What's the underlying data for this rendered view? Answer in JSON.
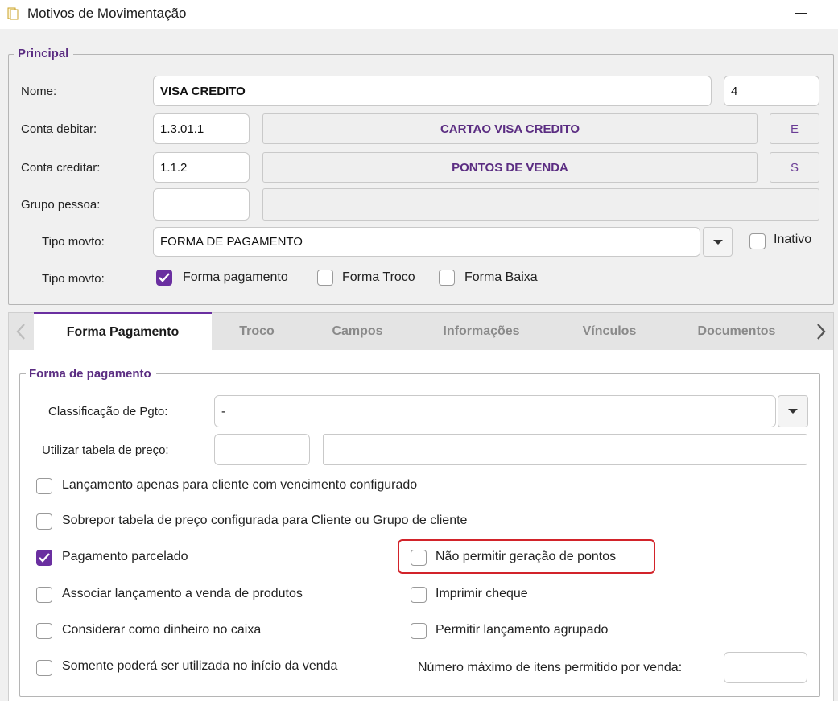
{
  "window": {
    "title": "Motivos de Movimentação"
  },
  "principal": {
    "legend": "Principal",
    "nome": {
      "label": "Nome:",
      "value": "VISA CREDITO",
      "code": "4"
    },
    "conta_debitar": {
      "label": "Conta debitar:",
      "code": "1.3.01.1",
      "description": "CARTAO VISA CREDITO",
      "flag": "E"
    },
    "conta_creditar": {
      "label": "Conta creditar:",
      "code": "1.1.2",
      "description": "PONTOS DE VENDA",
      "flag": "S"
    },
    "grupo_pessoa": {
      "label": "Grupo pessoa:",
      "code": "",
      "description": ""
    },
    "tipo_movto_select": {
      "label": "Tipo movto:",
      "value": "FORMA DE PAGAMENTO"
    },
    "inativo": {
      "label": "Inativo",
      "checked": false
    },
    "tipo_movto_checks": {
      "label": "Tipo movto:",
      "forma_pagamento": {
        "label": "Forma pagamento",
        "checked": true
      },
      "forma_troco": {
        "label": "Forma Troco",
        "checked": false
      },
      "forma_baixa": {
        "label": "Forma Baixa",
        "checked": false
      }
    }
  },
  "tabs": [
    {
      "label": "Forma Pagamento",
      "active": true
    },
    {
      "label": "Troco",
      "active": false
    },
    {
      "label": "Campos",
      "active": false
    },
    {
      "label": "Informações",
      "active": false
    },
    {
      "label": "Vínculos",
      "active": false
    },
    {
      "label": "Documentos",
      "active": false
    }
  ],
  "forma_pagamento": {
    "legend": "Forma de pagamento",
    "classificacao": {
      "label": "Classificação de Pgto:",
      "value": "-"
    },
    "tabela_preco": {
      "label": "Utilizar tabela de preço:",
      "code": "",
      "description": ""
    },
    "options": {
      "lancamento_apenas": {
        "label": "Lançamento apenas para cliente com vencimento configurado",
        "checked": false
      },
      "sobrepor_tabela": {
        "label": "Sobrepor tabela de preço configurada para Cliente ou Grupo de cliente",
        "checked": false
      },
      "pagamento_parcelado": {
        "label": "Pagamento parcelado",
        "checked": true
      },
      "nao_permitir_pontos": {
        "label": "Não permitir geração de pontos",
        "checked": false
      },
      "associar_lancamento": {
        "label": "Associar lançamento a venda de produtos",
        "checked": false
      },
      "imprimir_cheque": {
        "label": "Imprimir cheque",
        "checked": false
      },
      "considerar_dinheiro": {
        "label": "Considerar como dinheiro no caixa",
        "checked": false
      },
      "permitir_agrupado": {
        "label": "Permitir lançamento agrupado",
        "checked": false
      },
      "somente_inicio": {
        "label": "Somente poderá ser utilizada no início da venda",
        "checked": false
      }
    },
    "max_itens": {
      "label": "Número máximo de itens permitido por venda:",
      "value": ""
    }
  },
  "colors": {
    "accent": "#6a2fa0",
    "legend": "#5b2d82",
    "highlight": "#d2232a"
  }
}
